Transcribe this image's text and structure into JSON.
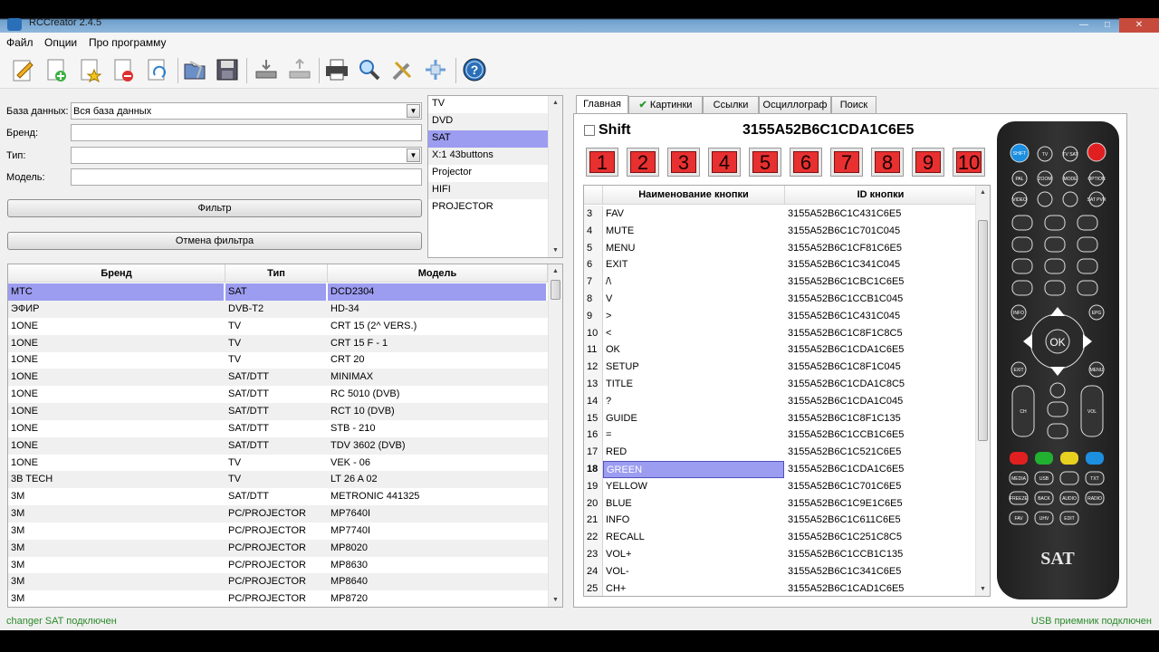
{
  "window": {
    "title": "RCCreator 2.4.5"
  },
  "menu": [
    "Файл",
    "Опции",
    "Про программу"
  ],
  "toolbar": {
    "icons": [
      "edit-icon",
      "add-icon",
      "star-icon",
      "remove-icon",
      "refresh-icon",
      "open-icon",
      "save-icon",
      "import-icon",
      "export-icon",
      "print-icon",
      "search-icon",
      "tools-icon",
      "move-icon",
      "help-icon"
    ]
  },
  "filter": {
    "db_label": "База данных:",
    "db_value": "Вся база данных",
    "brand_label": "Бренд:",
    "type_label": "Тип:",
    "model_label": "Модель:",
    "filter_button": "Фильтр",
    "reset_button": "Отмена фильтра"
  },
  "type_list": [
    "TV",
    "DVD",
    "SAT",
    "X:1 43buttons",
    "Projector",
    "HIFI",
    "PROJECTOR"
  ],
  "type_list_selected": 2,
  "grid": {
    "columns": [
      "Бренд",
      "Тип",
      "Модель"
    ],
    "rows": [
      [
        "MTC",
        "SAT",
        "DCD2304"
      ],
      [
        "ЭФИР",
        "DVB-T2",
        "HD-34"
      ],
      [
        "1ONE",
        "TV",
        "CRT 15 (2^ VERS.)"
      ],
      [
        "1ONE",
        "TV",
        "CRT 15 F - 1"
      ],
      [
        "1ONE",
        "TV",
        "CRT 20"
      ],
      [
        "1ONE",
        "SAT/DTT",
        "MINIMAX"
      ],
      [
        "1ONE",
        "SAT/DTT",
        "RC 5010 (DVB)"
      ],
      [
        "1ONE",
        "SAT/DTT",
        "RCT 10 (DVB)"
      ],
      [
        "1ONE",
        "SAT/DTT",
        "STB - 210"
      ],
      [
        "1ONE",
        "SAT/DTT",
        "TDV 3602 (DVB)"
      ],
      [
        "1ONE",
        "TV",
        "VEK - 06"
      ],
      [
        "3B TECH",
        "TV",
        "LT 26 A 02"
      ],
      [
        "3M",
        "SAT/DTT",
        "METRONIC 441325"
      ],
      [
        "3M",
        "PC/PROJECTOR",
        "MP7640I"
      ],
      [
        "3M",
        "PC/PROJECTOR",
        "MP7740I"
      ],
      [
        "3M",
        "PC/PROJECTOR",
        "MP8020"
      ],
      [
        "3M",
        "PC/PROJECTOR",
        "MP8630"
      ],
      [
        "3M",
        "PC/PROJECTOR",
        "MP8640"
      ],
      [
        "3M",
        "PC/PROJECTOR",
        "MP8720"
      ]
    ],
    "selected_row": 0
  },
  "tabs": [
    "Главная",
    "Картинки",
    "Ссылки",
    "Осциллограф",
    "Поиск"
  ],
  "main": {
    "shift_label": "Shift",
    "code": "3155A52B6C1CDA1C6E5",
    "num_buttons": [
      "1",
      "2",
      "3",
      "4",
      "5",
      "6",
      "7",
      "8",
      "9",
      "10"
    ]
  },
  "buttons_grid": {
    "columns": [
      "Наименование кнопки",
      "ID кнопки"
    ],
    "rows": [
      [
        "3",
        "FAV",
        "3155A52B6C1C431C6E5"
      ],
      [
        "4",
        "MUTE",
        "3155A52B6C1C701C045"
      ],
      [
        "5",
        "MENU",
        "3155A52B6C1CF81C6E5"
      ],
      [
        "6",
        "EXIT",
        "3155A52B6C1C341C045"
      ],
      [
        "7",
        "/\\",
        "3155A52B6C1CBC1C6E5"
      ],
      [
        "8",
        "V",
        "3155A52B6C1CCB1C045"
      ],
      [
        "9",
        ">",
        "3155A52B6C1C431C045"
      ],
      [
        "10",
        "<",
        "3155A52B6C1C8F1C8C5"
      ],
      [
        "11",
        "OK",
        "3155A52B6C1CDA1C6E5"
      ],
      [
        "12",
        "SETUP",
        "3155A52B6C1C8F1C045"
      ],
      [
        "13",
        "TITLE",
        "3155A52B6C1CDA1C8C5"
      ],
      [
        "14",
        "?",
        "3155A52B6C1CDA1C045"
      ],
      [
        "15",
        "GUIDE",
        "3155A52B6C1C8F1C135"
      ],
      [
        "16",
        "=",
        "3155A52B6C1CCB1C6E5"
      ],
      [
        "17",
        "RED",
        "3155A52B6C1C521C6E5"
      ],
      [
        "18",
        "GREEN",
        "3155A52B6C1CDA1C6E5"
      ],
      [
        "19",
        "YELLOW",
        "3155A52B6C1C701C6E5"
      ],
      [
        "20",
        "BLUE",
        "3155A52B6C1C9E1C6E5"
      ],
      [
        "21",
        "INFO",
        "3155A52B6C1C611C6E5"
      ],
      [
        "22",
        "RECALL",
        "3155A52B6C1C251C8C5"
      ],
      [
        "23",
        "VOL+",
        "3155A52B6C1CCB1C135"
      ],
      [
        "24",
        "VOL-",
        "3155A52B6C1C341C6E5"
      ],
      [
        "25",
        "CH+",
        "3155A52B6C1CAD1C6E5"
      ]
    ],
    "selected_row": 15
  },
  "remote": {
    "brand": "SAT",
    "buttons": {
      "shift": "SHIFT",
      "tv": "TV",
      "tvsat": "TV SAT",
      "pal": "PAL",
      "zoom": "ZOOM",
      "mode": "MODE",
      "option": "OPTION",
      "video": "VIDEO",
      "satpvr": "SAT PVR",
      "info": "INFO",
      "epg": "EPG",
      "exit": "EXIT",
      "menu": "MENU",
      "ok": "OK",
      "ch": "CH",
      "vol": "VOL",
      "media": "MEDIA",
      "usb": "USB",
      "txt": "TXT",
      "freeze": "FREEZE",
      "back": "BACK",
      "audio": "AUDIO",
      "radio": "RADIO",
      "fav": "FAV",
      "uhv": "UHV",
      "edit": "EDIT"
    }
  },
  "status": {
    "left": "changer SAT подключен",
    "right": "USB приемник подключен"
  },
  "colors": {
    "selection": "#9c9cf0",
    "status_green": "#2a8a2a",
    "num_red": "#e83030"
  }
}
